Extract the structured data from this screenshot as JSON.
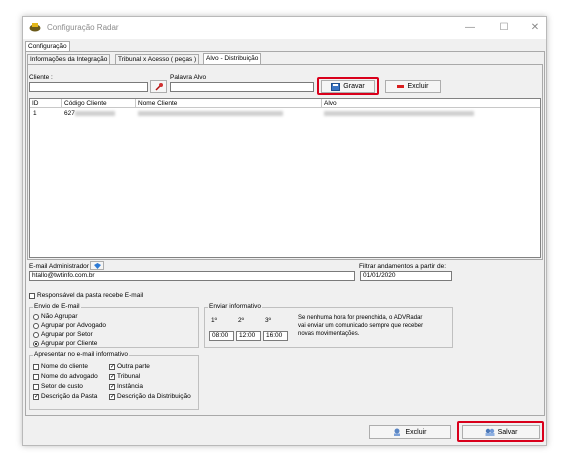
{
  "window": {
    "title": "Configuração Radar",
    "minimize": "—",
    "maximize": "☐",
    "close": "✕"
  },
  "tabs": {
    "top": "Configuração",
    "sub": [
      "Informações da Integração",
      "Tribunal x Acesso ( peças )",
      "Alvo - Distribuição"
    ]
  },
  "form": {
    "cliente_label": "Cliente :",
    "cliente_value": "",
    "palavra_label": "Palavra Alvo",
    "palavra_value": "",
    "gravar_label": "Gravar",
    "excluir_label": "Excluir"
  },
  "grid": {
    "headers": [
      "ID",
      "Código Cliente",
      "Nome Cliente",
      "Alvo"
    ],
    "rows": [
      {
        "id": "1",
        "codigo": "627"
      }
    ]
  },
  "email": {
    "admin_label": "E-mail Administrador",
    "admin_value": "htallo@twtinfo.com.br",
    "filtrar_label": "Filtrar andamentos a partir de:",
    "filtrar_value": "01/01/2020",
    "responsavel_label": "Responsável da pasta recebe E-mail"
  },
  "envio": {
    "title": "Envio de E-mail",
    "options": [
      "Não Agrupar",
      "Agrupar por Advogado",
      "Agrupar por Setor",
      "Agrupar por Cliente"
    ],
    "selected": "Agrupar por Cliente"
  },
  "enviar": {
    "title": "Enviar informativo",
    "cols": [
      "1º",
      "2º",
      "3º"
    ],
    "times": [
      "08:00",
      "12:00",
      "16:00"
    ],
    "note_lines": [
      "Se nenhuma hora for preenchida, o ADVRadar",
      "vai enviar um comunicado sempre que receber",
      "novas movimentações."
    ]
  },
  "apresentar": {
    "title": "Apresentar no e-mail informativo",
    "left": [
      {
        "label": "Nome do cliente",
        "checked": false
      },
      {
        "label": "Nome do advogado",
        "checked": false
      },
      {
        "label": "Setor de custo",
        "checked": false
      },
      {
        "label": "Descrição da Pasta",
        "checked": true
      }
    ],
    "right": [
      {
        "label": "Outra parte",
        "checked": true
      },
      {
        "label": "Tribunal",
        "checked": true
      },
      {
        "label": "Instância",
        "checked": true
      },
      {
        "label": "Descrição da Distribuição",
        "checked": true
      }
    ]
  },
  "footer": {
    "excluir_label": "Excluir",
    "salvar_label": "Salvar"
  },
  "colors": {
    "highlight": "#d9001b",
    "window_bg": "#f0f0f0"
  }
}
